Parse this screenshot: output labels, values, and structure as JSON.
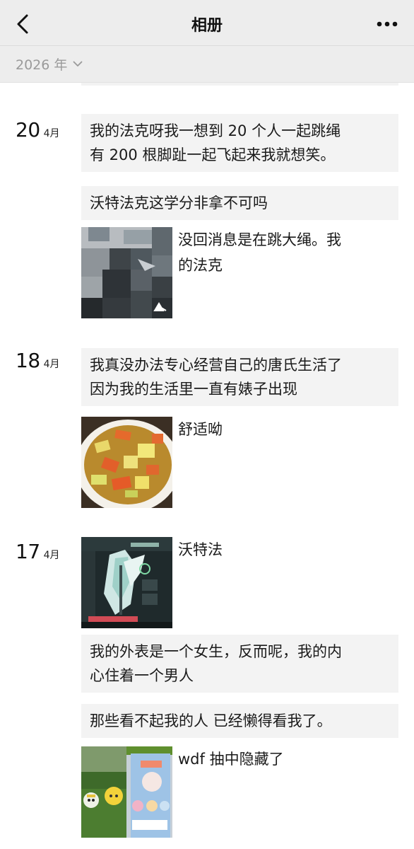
{
  "header": {
    "title": "相册",
    "back_icon": "chevron-left-icon",
    "more_icon": "more-dots-icon"
  },
  "filter": {
    "year_label": "2026 年",
    "icon": "chevron-down-icon"
  },
  "days": [
    {
      "day": "20",
      "month": "4月",
      "posts": [
        {
          "type": "text",
          "lines": [
            "我的法克呀我一想到 20 个人一起跳绳",
            "有 200 根脚趾一起飞起来我就想笑。"
          ]
        },
        {
          "type": "text",
          "lines": [
            "沃特法克这学分非拿不可吗"
          ]
        },
        {
          "type": "photo",
          "caption_lines": [
            "没回消息是在跳大绳。我",
            "的法克"
          ],
          "photo": "blurred-photo"
        }
      ]
    },
    {
      "day": "18",
      "month": "4月",
      "posts": [
        {
          "type": "text",
          "lines": [
            "我真没办法专心经营自己的唐氏生活了",
            "因为我的生活里一直有婊子出现"
          ]
        },
        {
          "type": "photo",
          "caption_lines": [
            "舒适呦"
          ],
          "photo": "food-bowl-photo"
        }
      ]
    },
    {
      "day": "17",
      "month": "4月",
      "posts": [
        {
          "type": "photo",
          "caption_lines": [
            "沃特法"
          ],
          "photo": "game-character-photo"
        },
        {
          "type": "text",
          "lines": [
            "我的外表是一个女生，反而呢，我的内",
            "心住着一个男人"
          ]
        },
        {
          "type": "text",
          "lines": [
            "那些看不起我的人 已经懒得看我了。"
          ]
        },
        {
          "type": "photo",
          "caption_lines": [
            "wdf 抽中隐藏了"
          ],
          "photo": "toy-figures-photo"
        }
      ]
    }
  ],
  "colors": {
    "header_bg": "#ededed",
    "post_bg": "#f3f3f3",
    "muted_text": "#9a9a9a"
  }
}
